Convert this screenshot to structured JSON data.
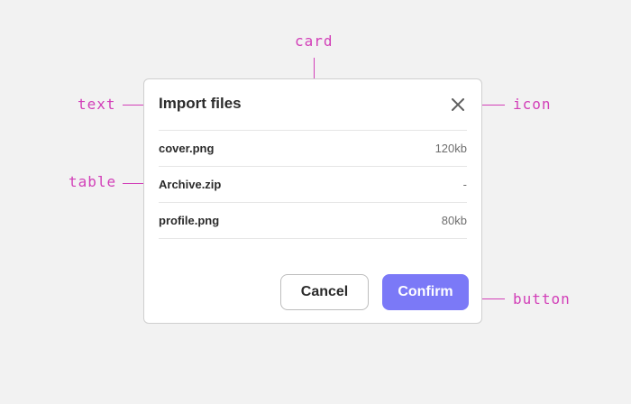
{
  "annotations": {
    "card": "card",
    "text": "text",
    "table": "table",
    "icon": "icon",
    "button": "button"
  },
  "dialog": {
    "title": "Import files",
    "close_icon": "close-icon",
    "files": [
      {
        "name": "cover.png",
        "size": "120kb"
      },
      {
        "name": "Archive.zip",
        "size": "-"
      },
      {
        "name": "profile.png",
        "size": "80kb"
      }
    ],
    "cancel_label": "Cancel",
    "confirm_label": "Confirm"
  },
  "colors": {
    "annotation": "#d23fb8",
    "primary_button": "#7b79f7",
    "background": "#f2f2f2"
  }
}
